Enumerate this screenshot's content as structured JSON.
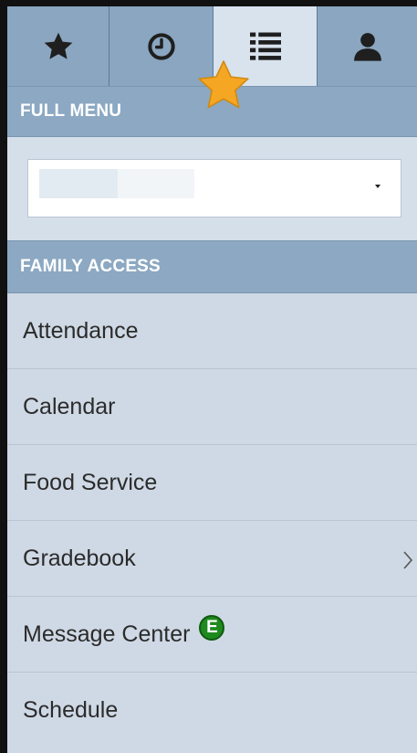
{
  "tabs": [
    {
      "name": "favorites",
      "icon": "star-icon"
    },
    {
      "name": "recent",
      "icon": "clock-icon"
    },
    {
      "name": "full-menu",
      "icon": "list-icon",
      "active": true
    },
    {
      "name": "account",
      "icon": "user-icon"
    }
  ],
  "full_menu": {
    "header": "FULL MENU",
    "select": {
      "selected_value": "",
      "caret_icon": "caret-down-icon"
    }
  },
  "family_access": {
    "header": "FAMILY ACCESS",
    "items": [
      {
        "label": "Attendance"
      },
      {
        "label": "Calendar"
      },
      {
        "label": "Food Service"
      },
      {
        "label": "Gradebook",
        "has_submenu": true
      },
      {
        "label": "Message Center",
        "badge": "E"
      },
      {
        "label": "Schedule"
      }
    ]
  },
  "colors": {
    "tab_bar": "#8aa6c0",
    "section_header": "#8ca8c2",
    "menu_bg": "#cfd9e5",
    "badge_green": "#1e8a1e",
    "favorite_star": "#f5a623"
  }
}
